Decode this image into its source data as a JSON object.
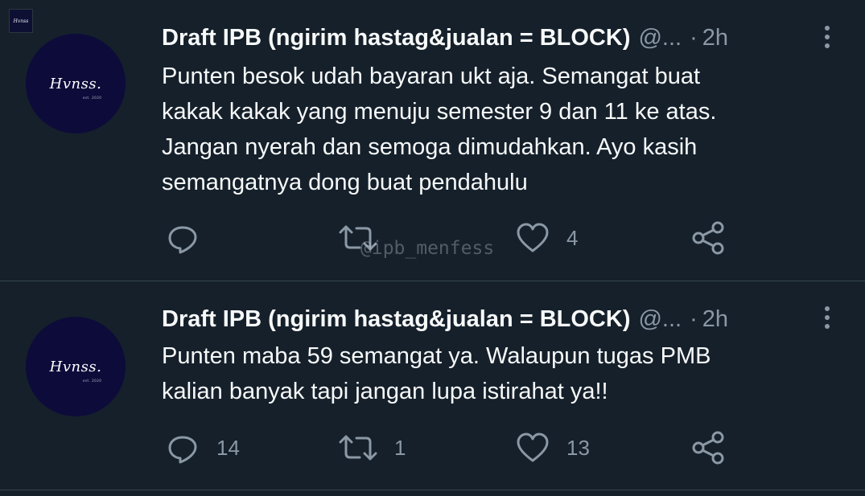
{
  "corner_logo": {
    "text": "Hvnss"
  },
  "tweets": [
    {
      "author_name": "Draft IPB (ngirim hastag&jualan = BLOCK)",
      "handle": "@...",
      "separator": "·",
      "time": "2h",
      "avatar_text": "Hvnss.",
      "avatar_est": "est. 2020",
      "lines": [
        "Punten besok udah bayaran ukt aja. Semangat buat",
        "kakak kakak yang menuju semester 9 dan 11 ke atas.",
        "Jangan nyerah dan semoga dimudahkan. Ayo kasih",
        "semangatnya dong buat pendahulu"
      ],
      "reply_count": "",
      "retweet_count": "",
      "like_count": "4"
    },
    {
      "author_name": "Draft IPB (ngirim hastag&jualan = BLOCK)",
      "handle": "@...",
      "separator": "·",
      "time": "2h",
      "avatar_text": "Hvnss.",
      "avatar_est": "est. 2020",
      "lines": [
        "Punten maba 59 semangat ya. Walaupun tugas PMB",
        "kalian banyak tapi jangan lupa istirahat ya!!"
      ],
      "reply_count": "14",
      "retweet_count": "1",
      "like_count": "13"
    }
  ],
  "watermark": "@ipb_menfess",
  "icons": {
    "reply": "reply-icon",
    "retweet": "retweet-icon",
    "like": "heart-icon",
    "share": "share-icon",
    "more": "more-vertical-icon"
  },
  "colors": {
    "background": "#15202b",
    "text": "#f7f9f9",
    "secondary": "#8b98a5",
    "divider": "#38444d",
    "avatar": "#0d0b3a"
  }
}
